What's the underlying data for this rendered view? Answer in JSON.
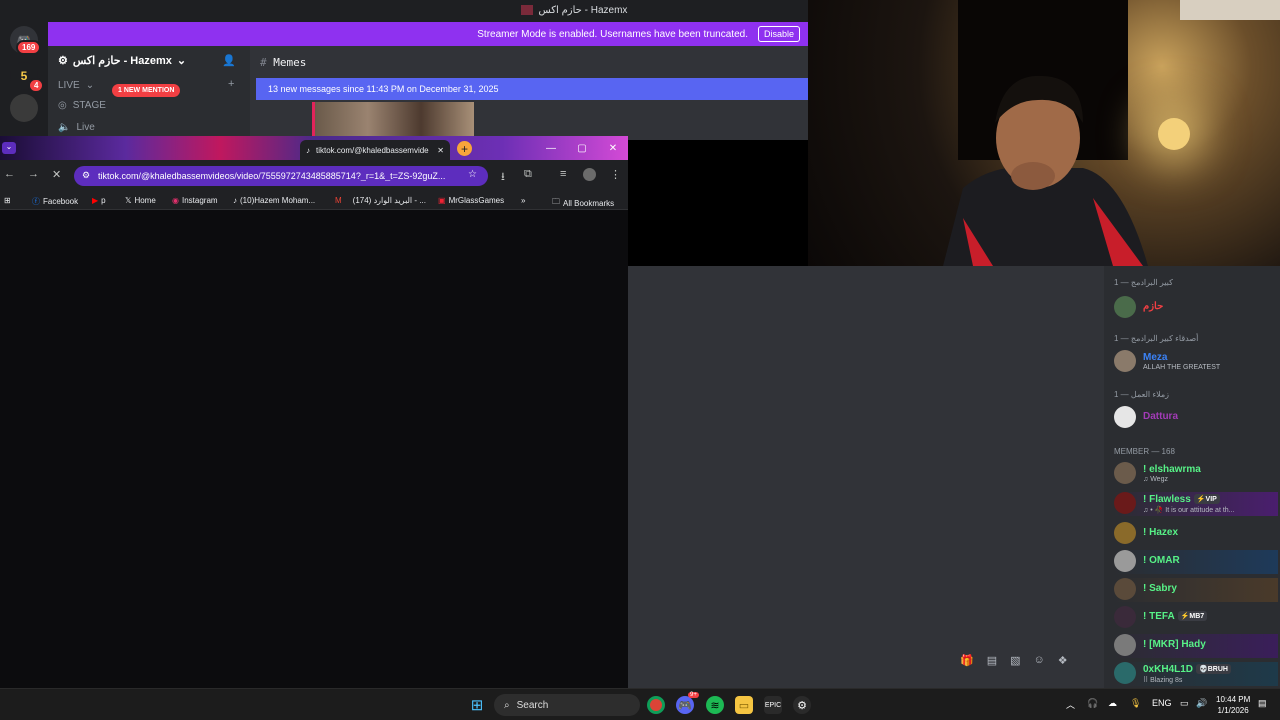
{
  "discord": {
    "window_title": "حازم اكس - Hazemx",
    "banner_text": "Streamer Mode is enabled. Usernames have been truncated.",
    "banner_button": "Disable",
    "server_badge": "169",
    "server_badge2": "4",
    "server_name": "حازم اكس - Hazemx",
    "live_category": "LIVE",
    "channels": [
      "STAGE",
      "Live"
    ],
    "mention_badge": "1 NEW MENTION",
    "channel_title": "Memes",
    "new_messages_bar": "13 new messages since 11:43 PM on December 31, 2025"
  },
  "chrome": {
    "tab_title": "tiktok.com/@khaledbassemvide",
    "url": "tiktok.com/@khaledbassemvideos/video/7555972743485885714?_r=1&_t=ZS-92guZ...",
    "bookmarks": [
      "Facebook",
      "p",
      "Home",
      "Instagram",
      "(10)Hazem Moham...",
      "(174) البريد الوارد - ...",
      "MrGlassGames"
    ],
    "all_bookmarks": "All Bookmarks"
  },
  "members": {
    "groups": [
      {
        "title": "كبير البرادمج — 1",
        "members": [
          {
            "name": "حازم",
            "status": "",
            "color": "#f23f43"
          }
        ]
      },
      {
        "title": "أصدقاء كبير البرادمج — 1",
        "members": [
          {
            "name": "Meza",
            "status": "ALLAH THE GREATEST",
            "color": "#3b82f6"
          }
        ]
      },
      {
        "title": "زملاء العمل — 1",
        "members": [
          {
            "name": "Dattura",
            "status": "",
            "color": "#a33bb7"
          }
        ]
      },
      {
        "title": "MEMBER — 168",
        "members": [
          {
            "name": "! elshawrma",
            "status": "♫ Wegz",
            "color": "#57f287",
            "tag": ""
          },
          {
            "name": "! Flawless",
            "status": "♫ • 🥀 It is our attitude at th...",
            "color": "#57f287",
            "tag": "⚡VIP"
          },
          {
            "name": "! Hazex",
            "status": "",
            "color": "#57f287",
            "tag": ""
          },
          {
            "name": "! OMAR",
            "status": "",
            "color": "#57f287",
            "tag": ""
          },
          {
            "name": "! Sabry",
            "status": "",
            "color": "#57f287",
            "tag": ""
          },
          {
            "name": "! TEFA",
            "status": "",
            "color": "#57f287",
            "tag": "⚡MB7"
          },
          {
            "name": "! [MKR] Hady",
            "status": "",
            "color": "#57f287",
            "tag": ""
          },
          {
            "name": "0xKH4L1D",
            "status": "⠿ Blazing 8s",
            "color": "#57f287",
            "tag": "💀BRUH"
          }
        ]
      }
    ]
  },
  "taskbar": {
    "search_placeholder": "Search",
    "lang": "ENG",
    "time": "10:44 PM",
    "date": "1/1/2026",
    "discord_badge": "9+"
  },
  "colors": {
    "accent": "#8f31f0",
    "discord_blurple": "#5865f2",
    "omnibox": "#5d2dbe"
  }
}
